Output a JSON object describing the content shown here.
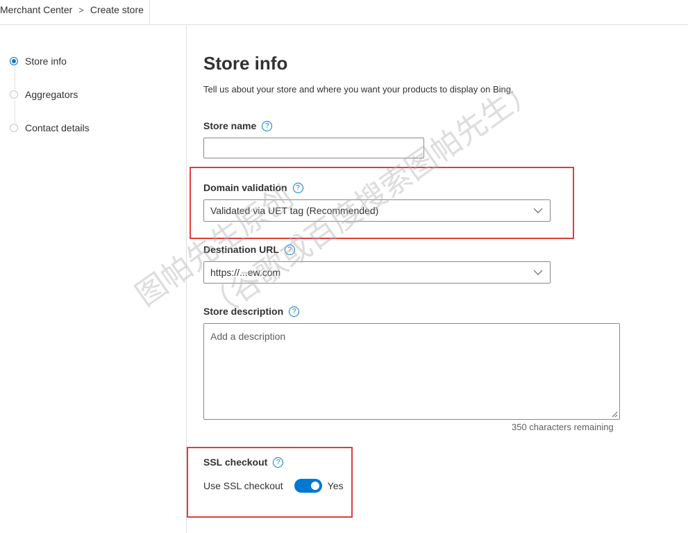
{
  "breadcrumb": {
    "items": [
      "Merchant Center",
      "Create store"
    ],
    "separator": ">"
  },
  "steps": [
    {
      "label": "Store info",
      "active": true
    },
    {
      "label": "Aggregators",
      "active": false
    },
    {
      "label": "Contact details",
      "active": false
    }
  ],
  "page": {
    "title": "Store info",
    "subtitle": "Tell us about your store and where you want your products to display on Bing."
  },
  "form": {
    "store_name": {
      "label": "Store name",
      "value": "",
      "help": "?"
    },
    "domain_validation": {
      "label": "Domain validation",
      "value": "Validated via UET tag (Recommended)",
      "help": "?"
    },
    "destination_url": {
      "label": "Destination URL",
      "value": "https://...ew.com",
      "help": "?"
    },
    "store_description": {
      "label": "Store description",
      "placeholder": "Add a description",
      "remaining": "350 characters remaining",
      "help": "?"
    },
    "ssl_checkout": {
      "label": "SSL checkout",
      "toggle_label": "Use SSL checkout",
      "toggle_state": "Yes",
      "on": true,
      "help": "?"
    }
  },
  "watermark": {
    "line1": "图帕先生原创",
    "line2": "（谷歌或百度搜索图帕先生）"
  },
  "colors": {
    "accent": "#0078d4",
    "highlight_box": "#e03c3c",
    "border": "#8a8886"
  }
}
